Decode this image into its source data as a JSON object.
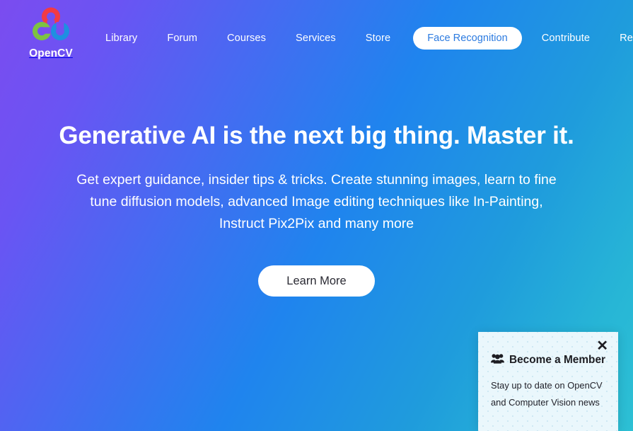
{
  "site": {
    "brand_name": "OpenCV",
    "logo_colors": {
      "top": "#f23a45",
      "left": "#7dc242",
      "right": "#1e8fe1"
    }
  },
  "nav": {
    "links": [
      {
        "label": "Library",
        "name": "library"
      },
      {
        "label": "Forum",
        "name": "forum"
      },
      {
        "label": "Courses",
        "name": "courses"
      },
      {
        "label": "Services",
        "name": "services"
      },
      {
        "label": "Store",
        "name": "store"
      }
    ],
    "highlighted": {
      "label": "Face Recognition",
      "bg": "#ffffff",
      "color": "#2c7be0"
    },
    "links_right": [
      {
        "label": "Contribute",
        "name": "contribute"
      },
      {
        "label": "Resources",
        "name": "resources"
      }
    ],
    "search_icon": "search-icon"
  },
  "hero": {
    "title": "Generative AI is the next big thing. Master it.",
    "subtitle": "Get expert guidance, insider tips & tricks. Create stunning images, learn to fine tune diffusion models, advanced Image editing techniques like In-Painting, Instruct Pix2Pix and many more",
    "cta_label": "Learn More"
  },
  "popup": {
    "title": "Become a Member",
    "body": "Stay up to date on OpenCV and Computer Vision news",
    "close_label": "✕",
    "icon": "users-icon",
    "background": "#eaf7fc"
  },
  "theme": {
    "gradient_start": "#7b4cf0",
    "gradient_mid": "#1f84ee",
    "gradient_end": "#2dc0d4",
    "text_on_gradient": "#ffffff"
  }
}
